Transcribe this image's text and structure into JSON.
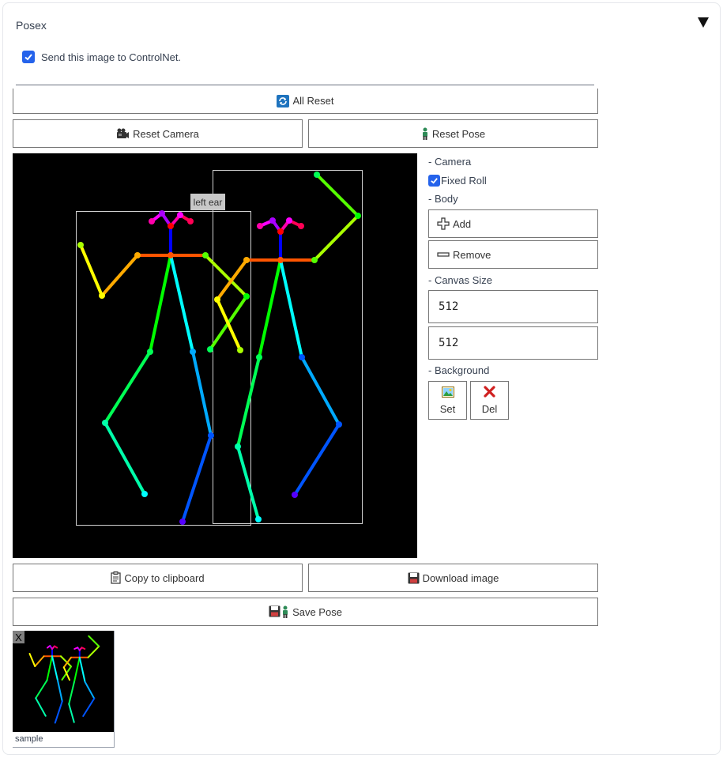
{
  "panel": {
    "title": "Posex"
  },
  "controlnet": {
    "label": "Send this image to ControlNet.",
    "checked": true
  },
  "buttons": {
    "all_reset": "All Reset",
    "reset_camera": "Reset Camera",
    "reset_pose": "Reset Pose",
    "copy_clipboard": "Copy to clipboard",
    "download_image": "Download image",
    "save_pose": "Save Pose"
  },
  "canvas": {
    "tooltip": "left ear"
  },
  "side": {
    "camera_label": "- Camera",
    "fixed_roll_label": "Fixed Roll",
    "fixed_roll_checked": true,
    "body_label": "- Body",
    "add_label": "Add",
    "remove_label": "Remove",
    "canvas_size_label": "- Canvas Size",
    "width": "512",
    "height": "512",
    "background_label": "- Background",
    "set_label": "Set",
    "del_label": "Del"
  },
  "saved": [
    {
      "caption": "sample",
      "close": "X"
    }
  ],
  "icons": {
    "collapse": "triangle-down-icon",
    "all_reset": "refresh-icon",
    "reset_camera": "camera-icon",
    "reset_pose": "person-icon",
    "add": "plus-icon",
    "remove": "minus-icon",
    "set": "picture-icon",
    "del": "red-x-icon",
    "copy": "clipboard-icon",
    "download": "floppy-icon",
    "save_pose": "floppy-person-icon"
  }
}
